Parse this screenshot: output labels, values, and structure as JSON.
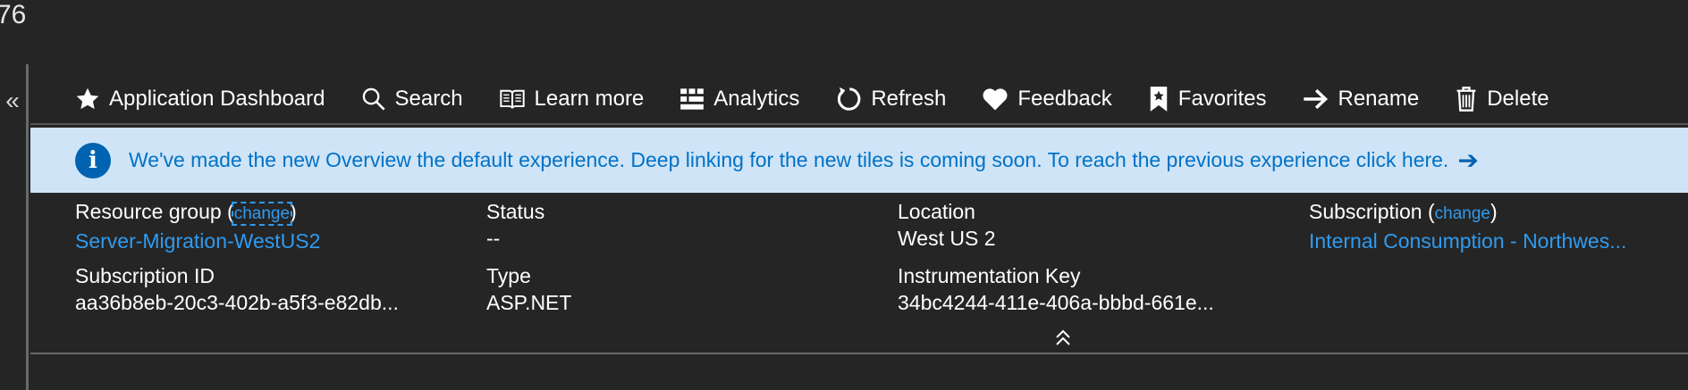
{
  "top_text": "76",
  "collapse_glyph": "«",
  "toolbar": {
    "items": [
      {
        "label": "Application Dashboard",
        "icon": "star-icon"
      },
      {
        "label": "Search",
        "icon": "search-icon"
      },
      {
        "label": "Learn more",
        "icon": "book-icon"
      },
      {
        "label": "Analytics",
        "icon": "analytics-grid-icon"
      },
      {
        "label": "Refresh",
        "icon": "refresh-icon"
      },
      {
        "label": "Feedback",
        "icon": "heart-icon"
      },
      {
        "label": "Favorites",
        "icon": "bookmark-star-icon"
      },
      {
        "label": "Rename",
        "icon": "arrow-right-icon"
      },
      {
        "label": "Delete",
        "icon": "trash-icon"
      }
    ]
  },
  "banner": {
    "icon": "info-icon",
    "icon_glyph": "i",
    "text": "We've made the new Overview the default experience. Deep linking for the new tiles is coming soon. To reach the previous experience click here.",
    "arrow": "➔"
  },
  "essentials": {
    "resource_group": {
      "label": "Resource group",
      "change": "change",
      "value": "Server-Migration-WestUS2"
    },
    "status": {
      "label": "Status",
      "value": "--"
    },
    "location": {
      "label": "Location",
      "value": "West US 2"
    },
    "subscription": {
      "label": "Subscription",
      "change": "change",
      "value": "Internal Consumption - Northwes..."
    },
    "subscription_id": {
      "label": "Subscription ID",
      "value": "aa36b8eb-20c3-402b-a5f3-e82db..."
    },
    "type": {
      "label": "Type",
      "value": "ASP.NET"
    },
    "instrumentation_key": {
      "label": "Instrumentation Key",
      "value": "34bc4244-411e-406a-bbbd-661e..."
    }
  },
  "colors": {
    "background": "#252525",
    "banner_bg": "#cfe4f7",
    "banner_text": "#0072c6",
    "link": "#2f9bf0",
    "info_icon": "#0063b1"
  }
}
